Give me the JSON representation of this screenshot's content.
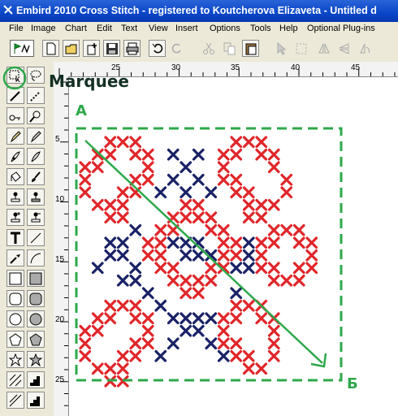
{
  "window": {
    "title": "Embird 2010 Cross Stitch - registered to Koutcherova Elizaveta - Untitled d"
  },
  "menu": {
    "items": [
      "File",
      "Image",
      "Chart",
      "Edit",
      "Text",
      "View",
      "Insert",
      "Options",
      "Tools",
      "Help",
      "Optional Plug-ins"
    ]
  },
  "ruler": {
    "top_labels": [
      "25",
      "30",
      "35",
      "40",
      "45"
    ],
    "left_labels": [
      "5",
      "10",
      "15",
      "20",
      "25"
    ]
  },
  "annotations": {
    "tool_callout": "Marquee",
    "start_letter": "А",
    "end_letter": "Б"
  },
  "colors": {
    "stitch_red": "#e0262a",
    "stitch_navy": "#1a2266",
    "annotation_green": "#2ea84a",
    "titlebar_blue": "#0a46c8"
  },
  "icons": {
    "toolbar": [
      "green-flag-icon",
      "new-icon",
      "open-icon",
      "add-icon",
      "save-icon",
      "print-icon",
      "undo-icon",
      "redo-icon",
      "cut-icon",
      "copy-icon",
      "paste-icon",
      "select-icon",
      "marquee-icon",
      "mirror-horizontal-icon",
      "mirror-vertical-icon",
      "rotate-icon"
    ],
    "tools": [
      "marquee-rect-icon",
      "lasso-icon",
      "pen-icon",
      "dotted-pen-icon",
      "key-icon",
      "magnifier-icon",
      "pencil-icon",
      "half-pencil-icon",
      "feather-icon",
      "feather-alt-icon",
      "bucket-icon",
      "brush-icon",
      "stamp-icon",
      "stamp-alt-icon",
      "stamp-plus-icon",
      "stamp-minus-icon",
      "text-icon",
      "line-icon",
      "dropper-icon",
      "curve-icon",
      "rectangle-icon",
      "rectangle-filled-icon",
      "rounded-rect-icon",
      "rounded-rect-filled-icon",
      "circle-icon",
      "circle-filled-icon",
      "pentagon-icon",
      "pentagon-filled-icon",
      "star-icon",
      "star-filled-icon",
      "diagonal-line-icon",
      "stairs-icon",
      "diagonal-alt-icon",
      "stairs-alt-icon"
    ]
  }
}
